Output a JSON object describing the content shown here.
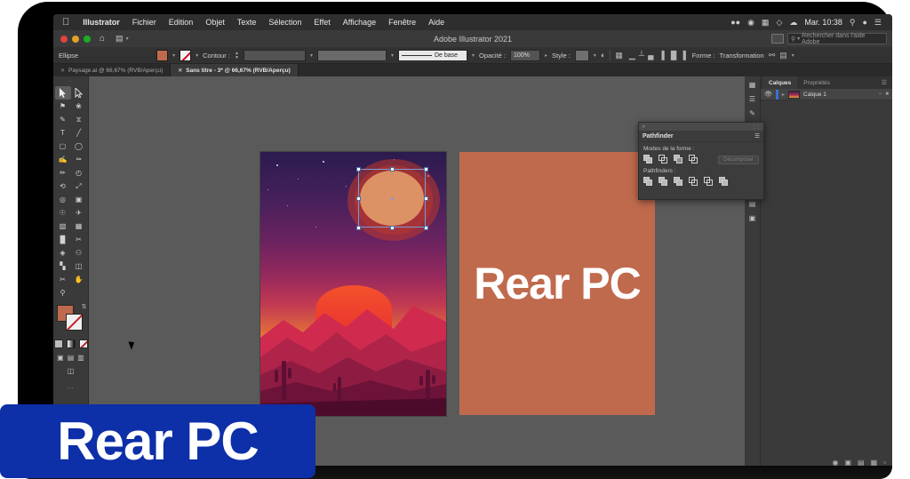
{
  "menubar": {
    "apple_icon": "apple-logo",
    "items": [
      "Illustrator",
      "Fichier",
      "Edition",
      "Objet",
      "Texte",
      "Sélection",
      "Effet",
      "Affichage",
      "Fenêtre",
      "Aide"
    ],
    "status_icons": [
      "screen-record-icon",
      "control-center-icon",
      "display-icon",
      "bluetooth-icon",
      "wifi-icon"
    ],
    "clock": "Mar. 10:38",
    "right_icons": [
      "search-icon",
      "siri-icon",
      "menu-list-icon"
    ]
  },
  "titlebar": {
    "app_title": "Adobe Illustrator 2021",
    "home_icon": "home-icon",
    "workspace_icon": "workspace-switcher-icon",
    "arrange_icon": "arrange-documents-icon",
    "search_placeholder": "Rechercher dans l'aide Adobe",
    "search_icon": "search-icon"
  },
  "controlbar": {
    "object_label": "Ellipse",
    "fill_swatch_color": "#c06a4d",
    "stroke_swatch": "none-swatch",
    "stroke_label": "Contour :",
    "stroke_weight_value": "",
    "stroke_profile_value": "",
    "brush_label": "De base",
    "opacity_label": "Opacité :",
    "opacity_value": "100%",
    "style_label": "Style :",
    "shape_label": "Forme :",
    "transform_label": "Transformation",
    "icons": [
      "opacity-icon",
      "mask-icon",
      "align-left-icon",
      "align-center-icon",
      "align-right-icon",
      "distribute-left-icon",
      "distribute-center-icon",
      "distribute-right-icon",
      "isolate-icon",
      "select-similar-icon"
    ]
  },
  "document_tabs": [
    {
      "label": "Paysage.ai @ 66,67% (RVB/Aperçu)",
      "active": false
    },
    {
      "label": "Sans titre - 3* @ 66,67% (RVB/Aperçu)",
      "active": true
    }
  ],
  "toolbar": {
    "tools": [
      {
        "name": "selection-tool",
        "glyph": "selection-arrow-icon",
        "active": true
      },
      {
        "name": "direct-selection-tool",
        "glyph": "direct-selection-icon",
        "active": false
      },
      {
        "name": "magic-wand-tool",
        "glyph": "magic-wand-icon",
        "active": false
      },
      {
        "name": "lasso-tool",
        "glyph": "lasso-icon",
        "active": false
      },
      {
        "name": "pen-tool",
        "glyph": "pen-icon",
        "active": false
      },
      {
        "name": "curvature-tool",
        "glyph": "curvature-icon",
        "active": false
      },
      {
        "name": "type-tool",
        "glyph": "type-icon",
        "active": false
      },
      {
        "name": "line-segment-tool",
        "glyph": "line-icon",
        "active": false
      },
      {
        "name": "rectangle-tool",
        "glyph": "rectangle-icon",
        "active": false
      },
      {
        "name": "paintbrush-tool",
        "glyph": "paintbrush-icon",
        "active": false
      },
      {
        "name": "shaper-tool",
        "glyph": "shaper-icon",
        "active": false
      },
      {
        "name": "pencil-tool",
        "glyph": "pencil-icon",
        "active": false
      },
      {
        "name": "rotate-tool",
        "glyph": "rotate-icon",
        "active": false
      },
      {
        "name": "scale-tool",
        "glyph": "scale-icon",
        "active": false
      },
      {
        "name": "width-tool",
        "glyph": "width-icon",
        "active": false
      },
      {
        "name": "free-transform-tool",
        "glyph": "free-transform-icon",
        "active": false
      },
      {
        "name": "shape-builder-tool",
        "glyph": "shape-builder-icon",
        "active": false
      },
      {
        "name": "perspective-grid-tool",
        "glyph": "perspective-icon",
        "active": false
      },
      {
        "name": "mesh-tool",
        "glyph": "mesh-icon",
        "active": false
      },
      {
        "name": "gradient-tool",
        "glyph": "gradient-icon",
        "active": false
      },
      {
        "name": "eyedropper-tool",
        "glyph": "eyedropper-icon",
        "active": false
      },
      {
        "name": "blend-tool",
        "glyph": "blend-icon",
        "active": false
      },
      {
        "name": "symbol-sprayer-tool",
        "glyph": "symbol-sprayer-icon",
        "active": false
      },
      {
        "name": "column-graph-tool",
        "glyph": "graph-icon",
        "active": false
      },
      {
        "name": "artboard-tool",
        "glyph": "artboard-icon",
        "active": false
      },
      {
        "name": "slice-tool",
        "glyph": "slice-icon",
        "active": false
      },
      {
        "name": "hand-tool",
        "glyph": "hand-icon",
        "active": false
      },
      {
        "name": "zoom-tool",
        "glyph": "zoom-icon",
        "active": false
      }
    ],
    "fill_color": "#c06a4d",
    "stroke_color": "none",
    "more_tools": "…"
  },
  "pathfinder": {
    "panel_title": "Pathfinder",
    "shape_modes_label": "Modes de la forme :",
    "decompose_label": "Décomposer",
    "pathfinders_label": "Pathfinders :",
    "shape_mode_buttons": [
      "unite-icon",
      "minus-front-icon",
      "intersect-icon",
      "exclude-icon"
    ],
    "pathfinder_buttons": [
      "divide-icon",
      "trim-icon",
      "merge-icon",
      "crop-icon",
      "outline-icon",
      "minus-back-icon"
    ],
    "close_icon": "close-icon",
    "menu_icon": "panel-menu-icon"
  },
  "right_panel": {
    "tabs": [
      {
        "label": "Calques",
        "active": true
      },
      {
        "label": "Propriétés",
        "active": false
      }
    ],
    "menu_icon": "panel-menu-icon",
    "layers": [
      {
        "name": "Calque 1",
        "visible": true,
        "visibility_icon": "eye-icon",
        "expand_icon": "chevron-right-icon",
        "color": "#3a6fd8"
      }
    ],
    "bottom_icons": [
      "locate-object-icon",
      "make-mask-icon",
      "new-sublayer-icon",
      "new-layer-icon",
      "delete-layer-icon"
    ]
  },
  "dock_icons": [
    "properties-dock-icon",
    "libraries-dock-icon",
    "brushes-dock-icon",
    "symbols-dock-icon",
    "align-dock-icon",
    "transform-dock-icon"
  ],
  "canvas": {
    "artboard_left_name": "paysage-artwork",
    "artboard_right_name": "rear-pc-artboard",
    "rear_text": "Rear PC",
    "rect_color": "#c06a4d",
    "selection_color": "#7b9cd8",
    "ellipse_color": "#dd9266"
  },
  "watermark": {
    "text": "Rear PC",
    "background_color": "#0d2fa8",
    "text_color": "#ffffff"
  }
}
